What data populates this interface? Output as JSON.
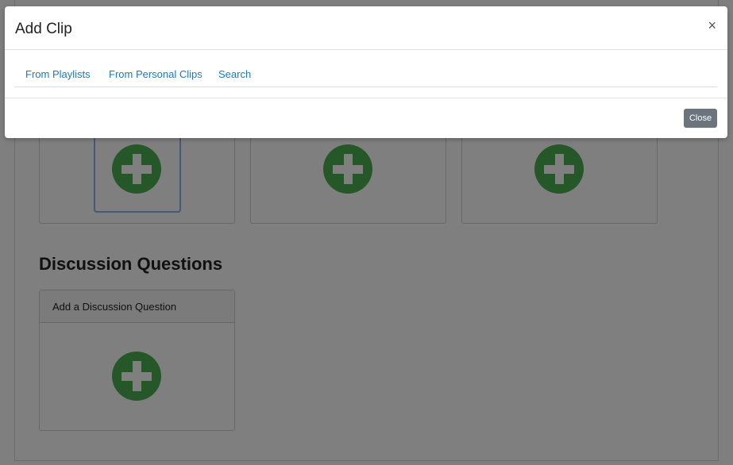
{
  "background": {
    "section_title": "Discussion Questions",
    "discussion_card_header": "Add a Discussion Question"
  },
  "modal": {
    "title": "Add Clip",
    "close_icon": "×",
    "tabs": [
      {
        "label": "From Playlists"
      },
      {
        "label": "From Personal Clips"
      },
      {
        "label": "Search"
      }
    ],
    "footer_close_label": "Close"
  },
  "icons": {
    "add": "plus-circle-icon",
    "close": "close-icon"
  },
  "colors": {
    "accent_green": "#4caf50",
    "link_blue": "#1a78c8",
    "close_button": "#6c757d"
  }
}
